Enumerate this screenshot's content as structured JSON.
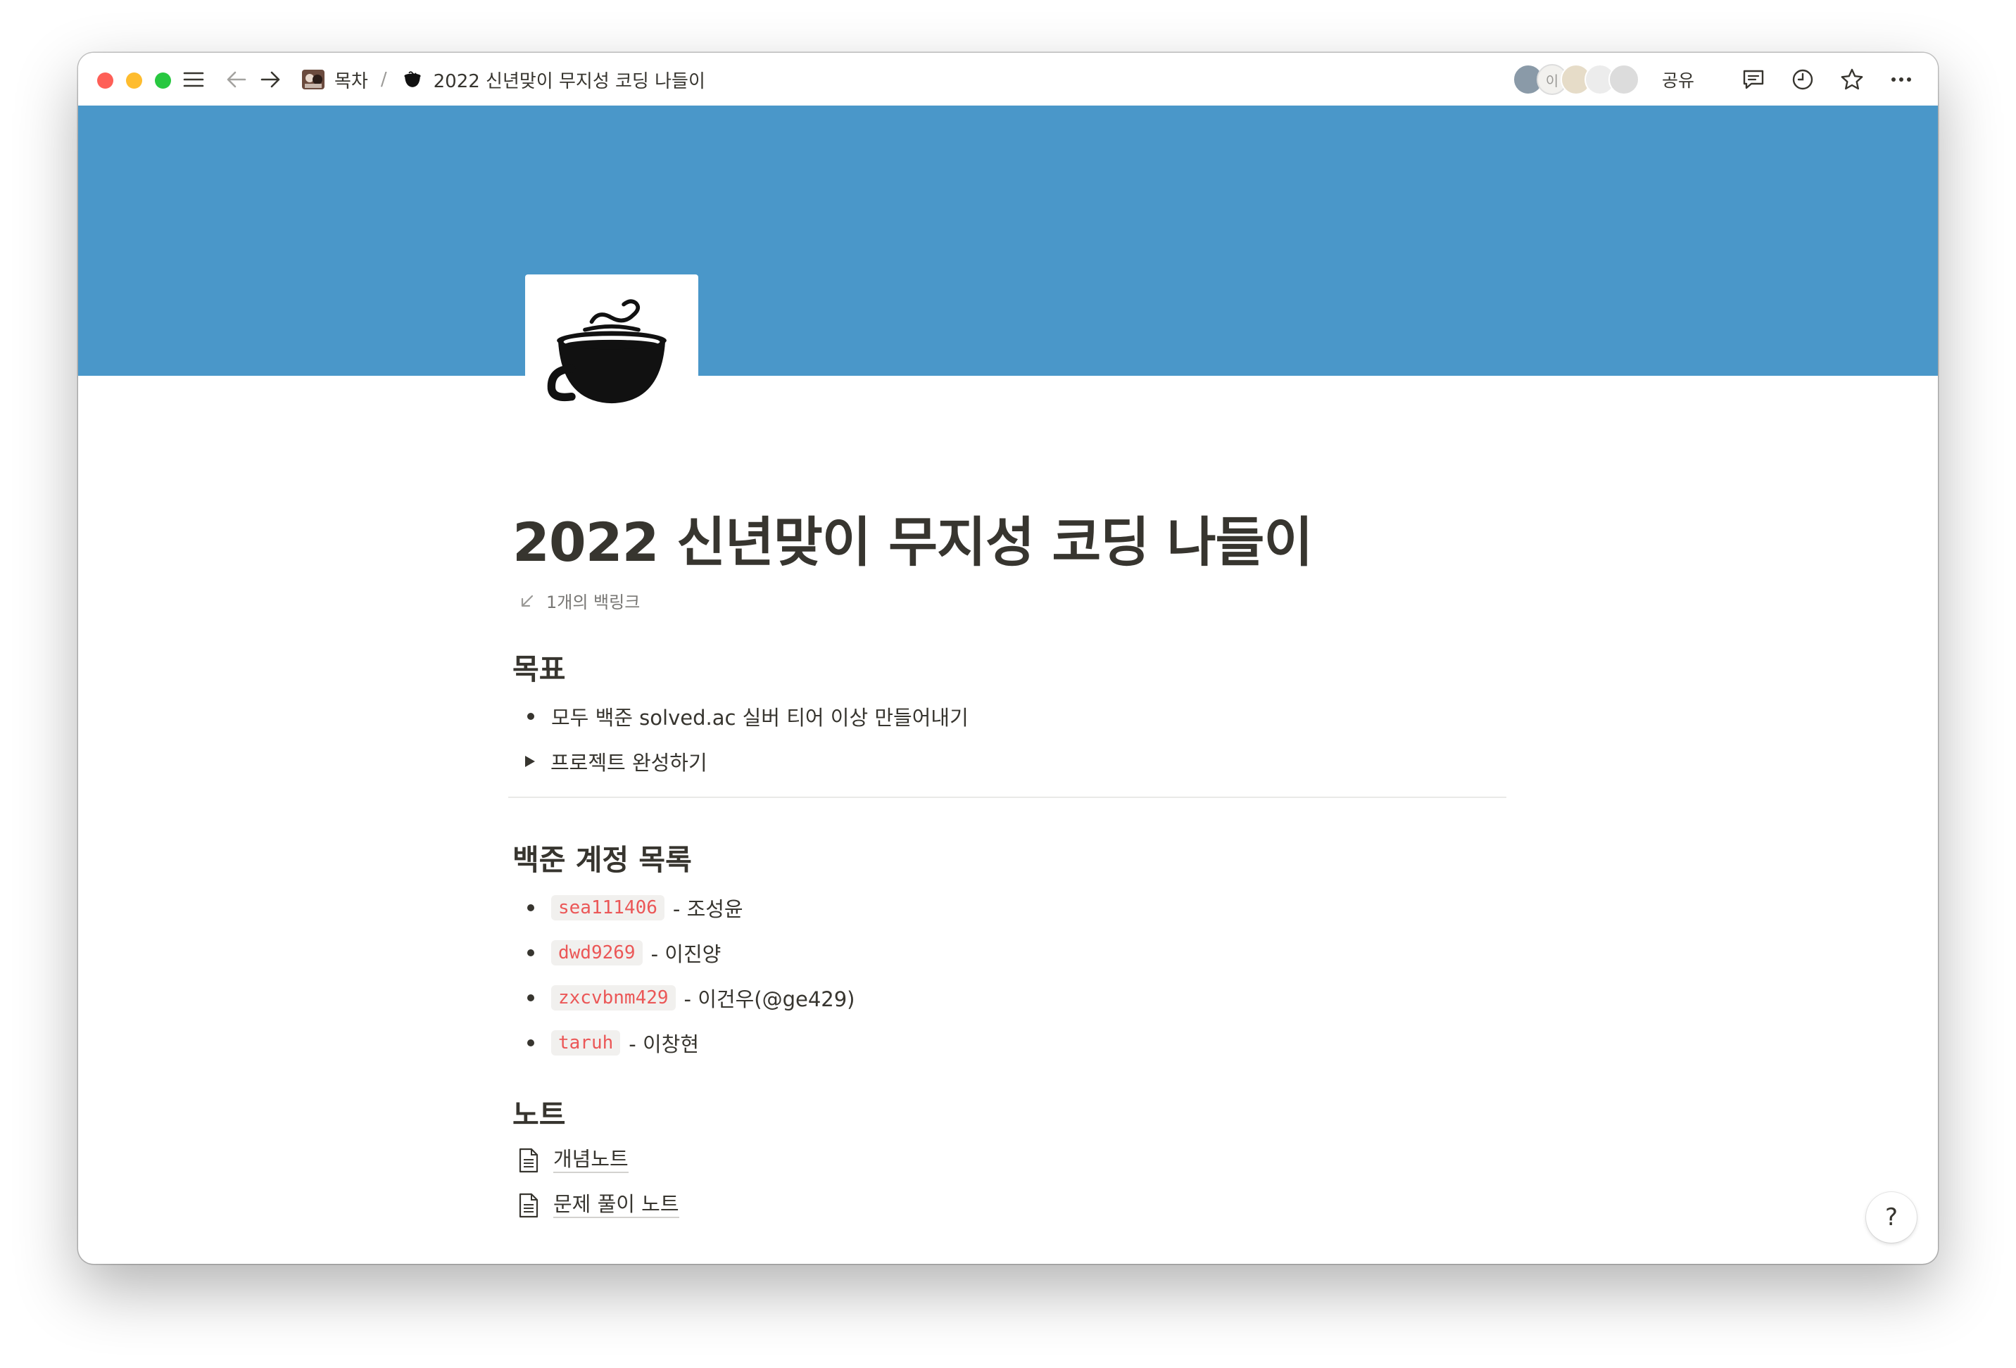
{
  "titlebar": {
    "breadcrumb_parent": "목차",
    "breadcrumb_separator": "/",
    "breadcrumb_current": "2022 신년맞이 무지성 코딩 나들이",
    "avatar_initial": "이",
    "share_label": "공유",
    "icons": [
      "menu-icon",
      "back-arrow-icon",
      "forward-arrow-icon",
      "comment-icon",
      "clock-icon",
      "star-icon",
      "more-icon"
    ]
  },
  "cover": {
    "color": "#4a97c9"
  },
  "page": {
    "icon": "coffee-cup-icon",
    "title": "2022 신년맞이 무지성 코딩 나들이",
    "backlinks": "1개의 백링크"
  },
  "sections": {
    "goal": {
      "heading": "목표",
      "bullet": "모두 백준 solved.ac 실버 티어 이상 만들어내기",
      "toggle": "프로젝트 완성하기"
    },
    "accounts": {
      "heading": "백준 계정 목록",
      "items": [
        {
          "code": "sea111406",
          "text": "- 조성윤"
        },
        {
          "code": "dwd9269",
          "text": "- 이진양"
        },
        {
          "code": "zxcvbnm429",
          "text": "- 이건우(@ge429)"
        },
        {
          "code": "taruh",
          "text": "- 이창현"
        }
      ]
    },
    "notes": {
      "heading": "노트",
      "links": [
        "개념노트",
        "문제 풀이 노트"
      ]
    }
  },
  "help": {
    "label": "?"
  },
  "colors": {
    "code_text": "#eb5757",
    "code_bg": "#f1f0ee",
    "text": "#37352f",
    "muted": "#787774"
  }
}
